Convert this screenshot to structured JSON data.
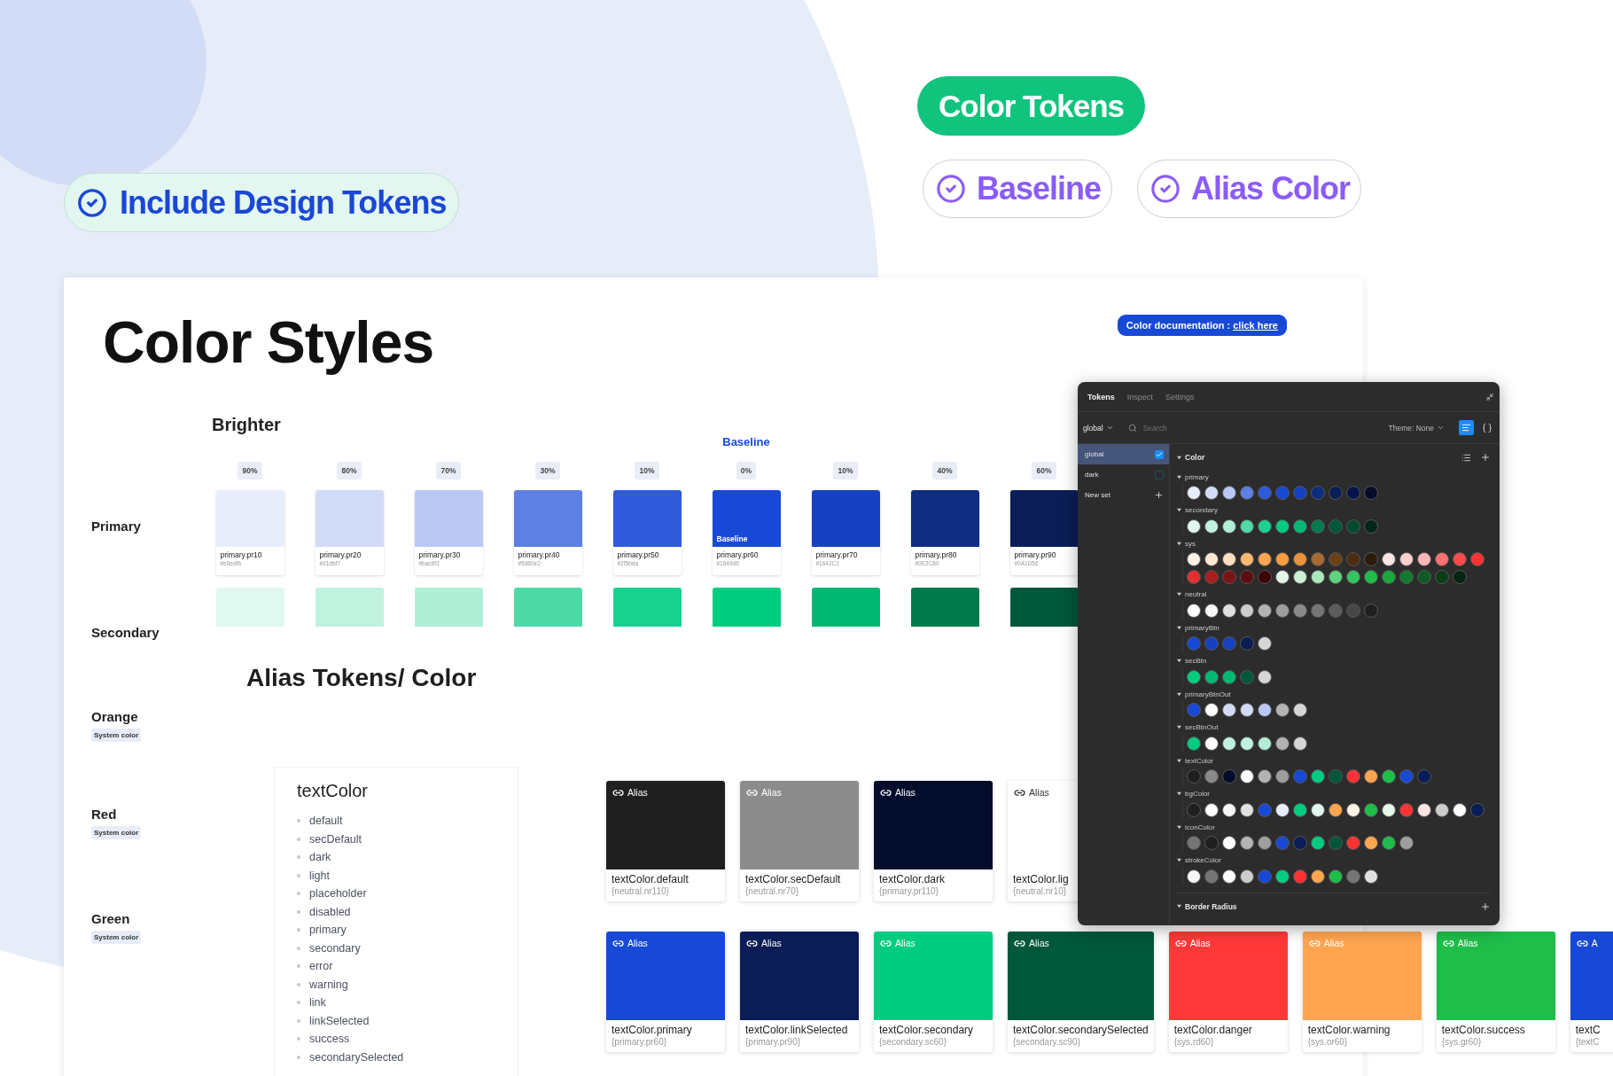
{
  "headline": {
    "label": "Color Tokens"
  },
  "include_badge": {
    "label": "Include Design Tokens"
  },
  "features": [
    {
      "label": "Baseline"
    },
    {
      "label": "Alias Color"
    }
  ],
  "document": {
    "title": "Color Styles",
    "doc_link": {
      "text": "Color documentation : ",
      "link": "click here"
    },
    "section_label": "Brighter",
    "baseline_label": "Baseline",
    "rows": [
      {
        "name": "Primary"
      },
      {
        "name": "Secondary"
      },
      {
        "name": "Orange",
        "tag": "System color"
      },
      {
        "name": "Red",
        "tag": "System color"
      },
      {
        "name": "Green",
        "tag": "System color"
      }
    ],
    "primary_swatches": [
      {
        "percent": "90%",
        "name": "primary.pr10",
        "hex": "#e8edfb",
        "color": "#e8edfb"
      },
      {
        "percent": "80%",
        "name": "primary.pr20",
        "hex": "#d1dbf7",
        "color": "#d1dbf7"
      },
      {
        "percent": "70%",
        "name": "primary.pr30",
        "hex": "#bac8f3",
        "color": "#bac8f3"
      },
      {
        "percent": "30%",
        "name": "primary.pr40",
        "hex": "#5d80e2",
        "color": "#5d80e2"
      },
      {
        "percent": "10%",
        "name": "primary.pr50",
        "hex": "#2f5bda",
        "color": "#2f5bda"
      },
      {
        "percent": "0%",
        "name": "primary.pr60",
        "hex": "#1849d6",
        "color": "#1849d6",
        "badge": "Baseline"
      },
      {
        "percent": "10%",
        "name": "primary.pr70",
        "hex": "#1642C1",
        "color": "#1642c1"
      },
      {
        "percent": "40%",
        "name": "primary.pr80",
        "hex": "#0E2C80",
        "color": "#0e2c80"
      },
      {
        "percent": "60%",
        "name": "primary.pr90",
        "hex": "#0A1D56",
        "color": "#0a1d56"
      }
    ],
    "secondary_swatches": [
      {
        "color": "#e0f8ef"
      },
      {
        "color": "#c1f1df"
      },
      {
        "color": "#b0eed6"
      },
      {
        "color": "#4fd9a6"
      },
      {
        "color": "#1ad28f"
      },
      {
        "color": "#00cc80"
      },
      {
        "color": "#00b874"
      },
      {
        "color": "#007a4d"
      },
      {
        "color": "#00573a"
      }
    ],
    "alias_title": "Alias Tokens/ Color",
    "token_list": {
      "title": "textColor",
      "items": [
        "default",
        "secDefault",
        "dark",
        "light",
        "placeholder",
        "disabled",
        "primary",
        "secondary",
        "error",
        "warning",
        "link",
        "linkSelected",
        "success",
        "secondarySelected"
      ]
    },
    "alias_rows": [
      {
        "cards": [
          {
            "tag": "Alias",
            "label": "textColor.default",
            "ref": "{neutral.nr110}",
            "color": "#1f1f1f"
          },
          {
            "tag": "Alias",
            "label": "textColor.secDefault",
            "ref": "{neutral.nr70}",
            "color": "#8c8c8c"
          },
          {
            "tag": "Alias",
            "label": "textColor.dark",
            "ref": "{primary.pr110}",
            "color": "#030c2b"
          },
          {
            "tag": "Alias",
            "label": "textColor.lig",
            "ref": "{neutral.nr10}",
            "color": "#ffffff"
          }
        ]
      },
      {
        "cards": [
          {
            "tag": "Alias",
            "label": "textColor.primary",
            "ref": "{primary.pr60}",
            "color": "#1849d6"
          },
          {
            "tag": "Alias",
            "label": "textColor.linkSelected",
            "ref": "{primary.pr90}",
            "color": "#0a1d56"
          },
          {
            "tag": "Alias",
            "label": "textColor.secondary",
            "ref": "{secondary.sc60}",
            "color": "#00cc80"
          },
          {
            "tag": "Alias",
            "label": "textColor.secondarySelected",
            "ref": "{secondary.sc90}",
            "color": "#00573a"
          },
          {
            "tag": "Alias",
            "label": "textColor.danger",
            "ref": "{sys.rd60}",
            "color": "#ff3838"
          },
          {
            "tag": "Alias",
            "label": "textColor.warning",
            "ref": "{sys.or60}",
            "color": "#ffa54f"
          },
          {
            "tag": "Alias",
            "label": "textColor.success",
            "ref": "{sys.gr60}",
            "color": "#1fbd4a"
          },
          {
            "tag": "A",
            "label": "textC",
            "ref": "{textC",
            "color": "#1849d6"
          }
        ]
      }
    ]
  },
  "tokens_panel": {
    "tabs": [
      {
        "label": "Tokens",
        "selected": true
      },
      {
        "label": "Inspect",
        "selected": false
      },
      {
        "label": "Settings",
        "selected": false
      }
    ],
    "set_select": "global",
    "search": {
      "placeholder": "Search"
    },
    "theme": "Theme: None",
    "views": [
      {
        "kind": "list",
        "selected": true
      },
      {
        "kind": "json",
        "selected": false
      }
    ],
    "sets": [
      {
        "kind": "set",
        "label": "global",
        "selected": true,
        "checked": true
      },
      {
        "kind": "set",
        "label": "dark",
        "selected": false,
        "checked": false
      },
      {
        "kind": "add",
        "label": "New set",
        "selected": false
      }
    ],
    "sections": [
      {
        "title": "Color",
        "expanded": true,
        "groups": [
          {
            "name": "primary",
            "expanded": true,
            "swatches": [
              {
                "color": "#e8edfb"
              },
              {
                "color": "#d1dbf7"
              },
              {
                "color": "#bac8f3"
              },
              {
                "color": "#5d80e2"
              },
              {
                "color": "#2f5bda"
              },
              {
                "color": "#1849d6"
              },
              {
                "color": "#1642c1"
              },
              {
                "color": "#0e2c80"
              },
              {
                "color": "#0a1d56"
              },
              {
                "color": "#07164a"
              },
              {
                "color": "#030c2b"
              }
            ]
          },
          {
            "name": "secondary",
            "expanded": true,
            "swatches": [
              {
                "color": "#e0f8ef"
              },
              {
                "color": "#c1f1df"
              },
              {
                "color": "#b0eed6"
              },
              {
                "color": "#4fd9a6"
              },
              {
                "color": "#1ad28f"
              },
              {
                "color": "#00cc80"
              },
              {
                "color": "#00b874"
              },
              {
                "color": "#007a4d"
              },
              {
                "color": "#00573a"
              },
              {
                "color": "#004a2e"
              },
              {
                "color": "#002618"
              }
            ]
          },
          {
            "name": "sys",
            "expanded": true,
            "swatches": [
              {
                "color": "#fff3e6"
              },
              {
                "color": "#ffe8d1"
              },
              {
                "color": "#ffdfbf"
              },
              {
                "color": "#ffb870"
              },
              {
                "color": "#ffa54f"
              },
              {
                "color": "#fb9d3f"
              },
              {
                "color": "#e8923a"
              },
              {
                "color": "#a86a33"
              },
              {
                "color": "#6b4218"
              },
              {
                "color": "#4d2d10"
              },
              {
                "color": "#2e1a08"
              },
              {
                "color": "#ffe4e4"
              },
              {
                "color": "#ffcfcf"
              },
              {
                "color": "#ffb5b5"
              },
              {
                "color": "#ff7070"
              },
              {
                "color": "#ff4a4a"
              },
              {
                "color": "#ff3333"
              },
              {
                "color": "#e23030"
              },
              {
                "color": "#a81f1f"
              },
              {
                "color": "#7a1515"
              },
              {
                "color": "#5c0f0f"
              },
              {
                "color": "#3d0707"
              },
              {
                "color": "#e5f8ea"
              },
              {
                "color": "#c9f0d3"
              },
              {
                "color": "#ade8bd"
              },
              {
                "color": "#5fd27e"
              },
              {
                "color": "#36c45e"
              },
              {
                "color": "#1fbd4a"
              },
              {
                "color": "#1aa83f"
              },
              {
                "color": "#147a30"
              },
              {
                "color": "#0f5c24"
              },
              {
                "color": "#0a3d18"
              },
              {
                "color": "#052610"
              }
            ]
          },
          {
            "name": "neutral",
            "expanded": true,
            "swatches": [
              {
                "color": "#ffffff"
              },
              {
                "color": "#f7f7f7"
              },
              {
                "color": "#e0e0e0"
              },
              {
                "color": "#cccccc"
              },
              {
                "color": "#b3b3b3"
              },
              {
                "color": "#9e9e9e"
              },
              {
                "color": "#8a8a8a"
              },
              {
                "color": "#757575"
              },
              {
                "color": "#5c5c5c"
              },
              {
                "color": "#474747"
              },
              {
                "color": "#1f1f1f"
              }
            ]
          },
          {
            "name": "primaryBtn",
            "expanded": true,
            "swatches": [
              {
                "color": "#1849d6"
              },
              {
                "color": "#1642c1"
              },
              {
                "color": "#1642c1"
              },
              {
                "color": "#0a1d56"
              },
              {
                "color": "#d6d6d6"
              }
            ]
          },
          {
            "name": "secBtn",
            "expanded": true,
            "swatches": [
              {
                "color": "#00cc80"
              },
              {
                "color": "#00b874"
              },
              {
                "color": "#00b874"
              },
              {
                "color": "#00573a"
              },
              {
                "color": "#d6d6d6"
              }
            ]
          },
          {
            "name": "primaryBtnOut",
            "expanded": true,
            "swatches": [
              {
                "color": "#1849d6"
              },
              {
                "color": "#ffffff"
              },
              {
                "color": "#d1dbf7"
              },
              {
                "color": "#d1dbf7"
              },
              {
                "color": "#bac8f3"
              },
              {
                "color": "#b3b3b3"
              },
              {
                "color": "#d6d6d6"
              }
            ]
          },
          {
            "name": "secBtnOut",
            "expanded": true,
            "swatches": [
              {
                "color": "#00cc80"
              },
              {
                "color": "#ffffff"
              },
              {
                "color": "#c1f1df"
              },
              {
                "color": "#c1f1df"
              },
              {
                "color": "#b0eed6"
              },
              {
                "color": "#b3b3b3"
              },
              {
                "color": "#d6d6d6"
              }
            ]
          },
          {
            "name": "textColor",
            "expanded": true,
            "swatches": [
              {
                "color": "#1f1f1f"
              },
              {
                "color": "#8a8a8a"
              },
              {
                "color": "#030c2b"
              },
              {
                "color": "#ffffff"
              },
              {
                "color": "#b3b3b3"
              },
              {
                "color": "#9e9e9e"
              },
              {
                "color": "#1849d6"
              },
              {
                "color": "#00cc80"
              },
              {
                "color": "#00573a"
              },
              {
                "color": "#ff3333"
              },
              {
                "color": "#ffa54f"
              },
              {
                "color": "#1fbd4a"
              },
              {
                "color": "#1849d6"
              },
              {
                "color": "#0a1d56"
              }
            ]
          },
          {
            "name": "bgColor",
            "expanded": true,
            "swatches": [
              {
                "color": "#1f1f1f"
              },
              {
                "color": "#ffffff"
              },
              {
                "color": "#f7f7f7"
              },
              {
                "color": "#e0e0e0"
              },
              {
                "color": "#1849d6"
              },
              {
                "color": "#e8edfb"
              },
              {
                "color": "#00cc80"
              },
              {
                "color": "#e0f8ef"
              },
              {
                "color": "#ffa54f"
              },
              {
                "color": "#fff3e6"
              },
              {
                "color": "#1fbd4a"
              },
              {
                "color": "#e5f8ea"
              },
              {
                "color": "#ff3333"
              },
              {
                "color": "#ffe4e4"
              },
              {
                "color": "#cccccc"
              },
              {
                "color": "#ffffff"
              },
              {
                "color": "#0a1d56"
              }
            ]
          },
          {
            "name": "iconColor",
            "expanded": true,
            "swatches": [
              {
                "color": "#757575"
              },
              {
                "color": "#1f1f1f"
              },
              {
                "color": "#ffffff"
              },
              {
                "color": "#b3b3b3"
              },
              {
                "color": "#9e9e9e"
              },
              {
                "color": "#1849d6"
              },
              {
                "color": "#0a1d56"
              },
              {
                "color": "#00cc80"
              },
              {
                "color": "#00573a"
              },
              {
                "color": "#ff3333"
              },
              {
                "color": "#ffa54f"
              },
              {
                "color": "#1fbd4a"
              },
              {
                "color": "#9e9e9e"
              }
            ]
          },
          {
            "name": "strokeColor",
            "expanded": true,
            "swatches": [
              {
                "color": "#f7f7f7"
              },
              {
                "color": "#757575"
              },
              {
                "color": "#ffffff"
              },
              {
                "color": "#cccccc"
              },
              {
                "color": "#1849d6"
              },
              {
                "color": "#00cc80"
              },
              {
                "color": "#ff3333"
              },
              {
                "color": "#ffa54f"
              },
              {
                "color": "#1fbd4a"
              },
              {
                "color": "#757575"
              },
              {
                "color": "#e0e0e0"
              }
            ]
          }
        ]
      },
      {
        "title": "Border Radius",
        "expanded": true
      }
    ]
  }
}
